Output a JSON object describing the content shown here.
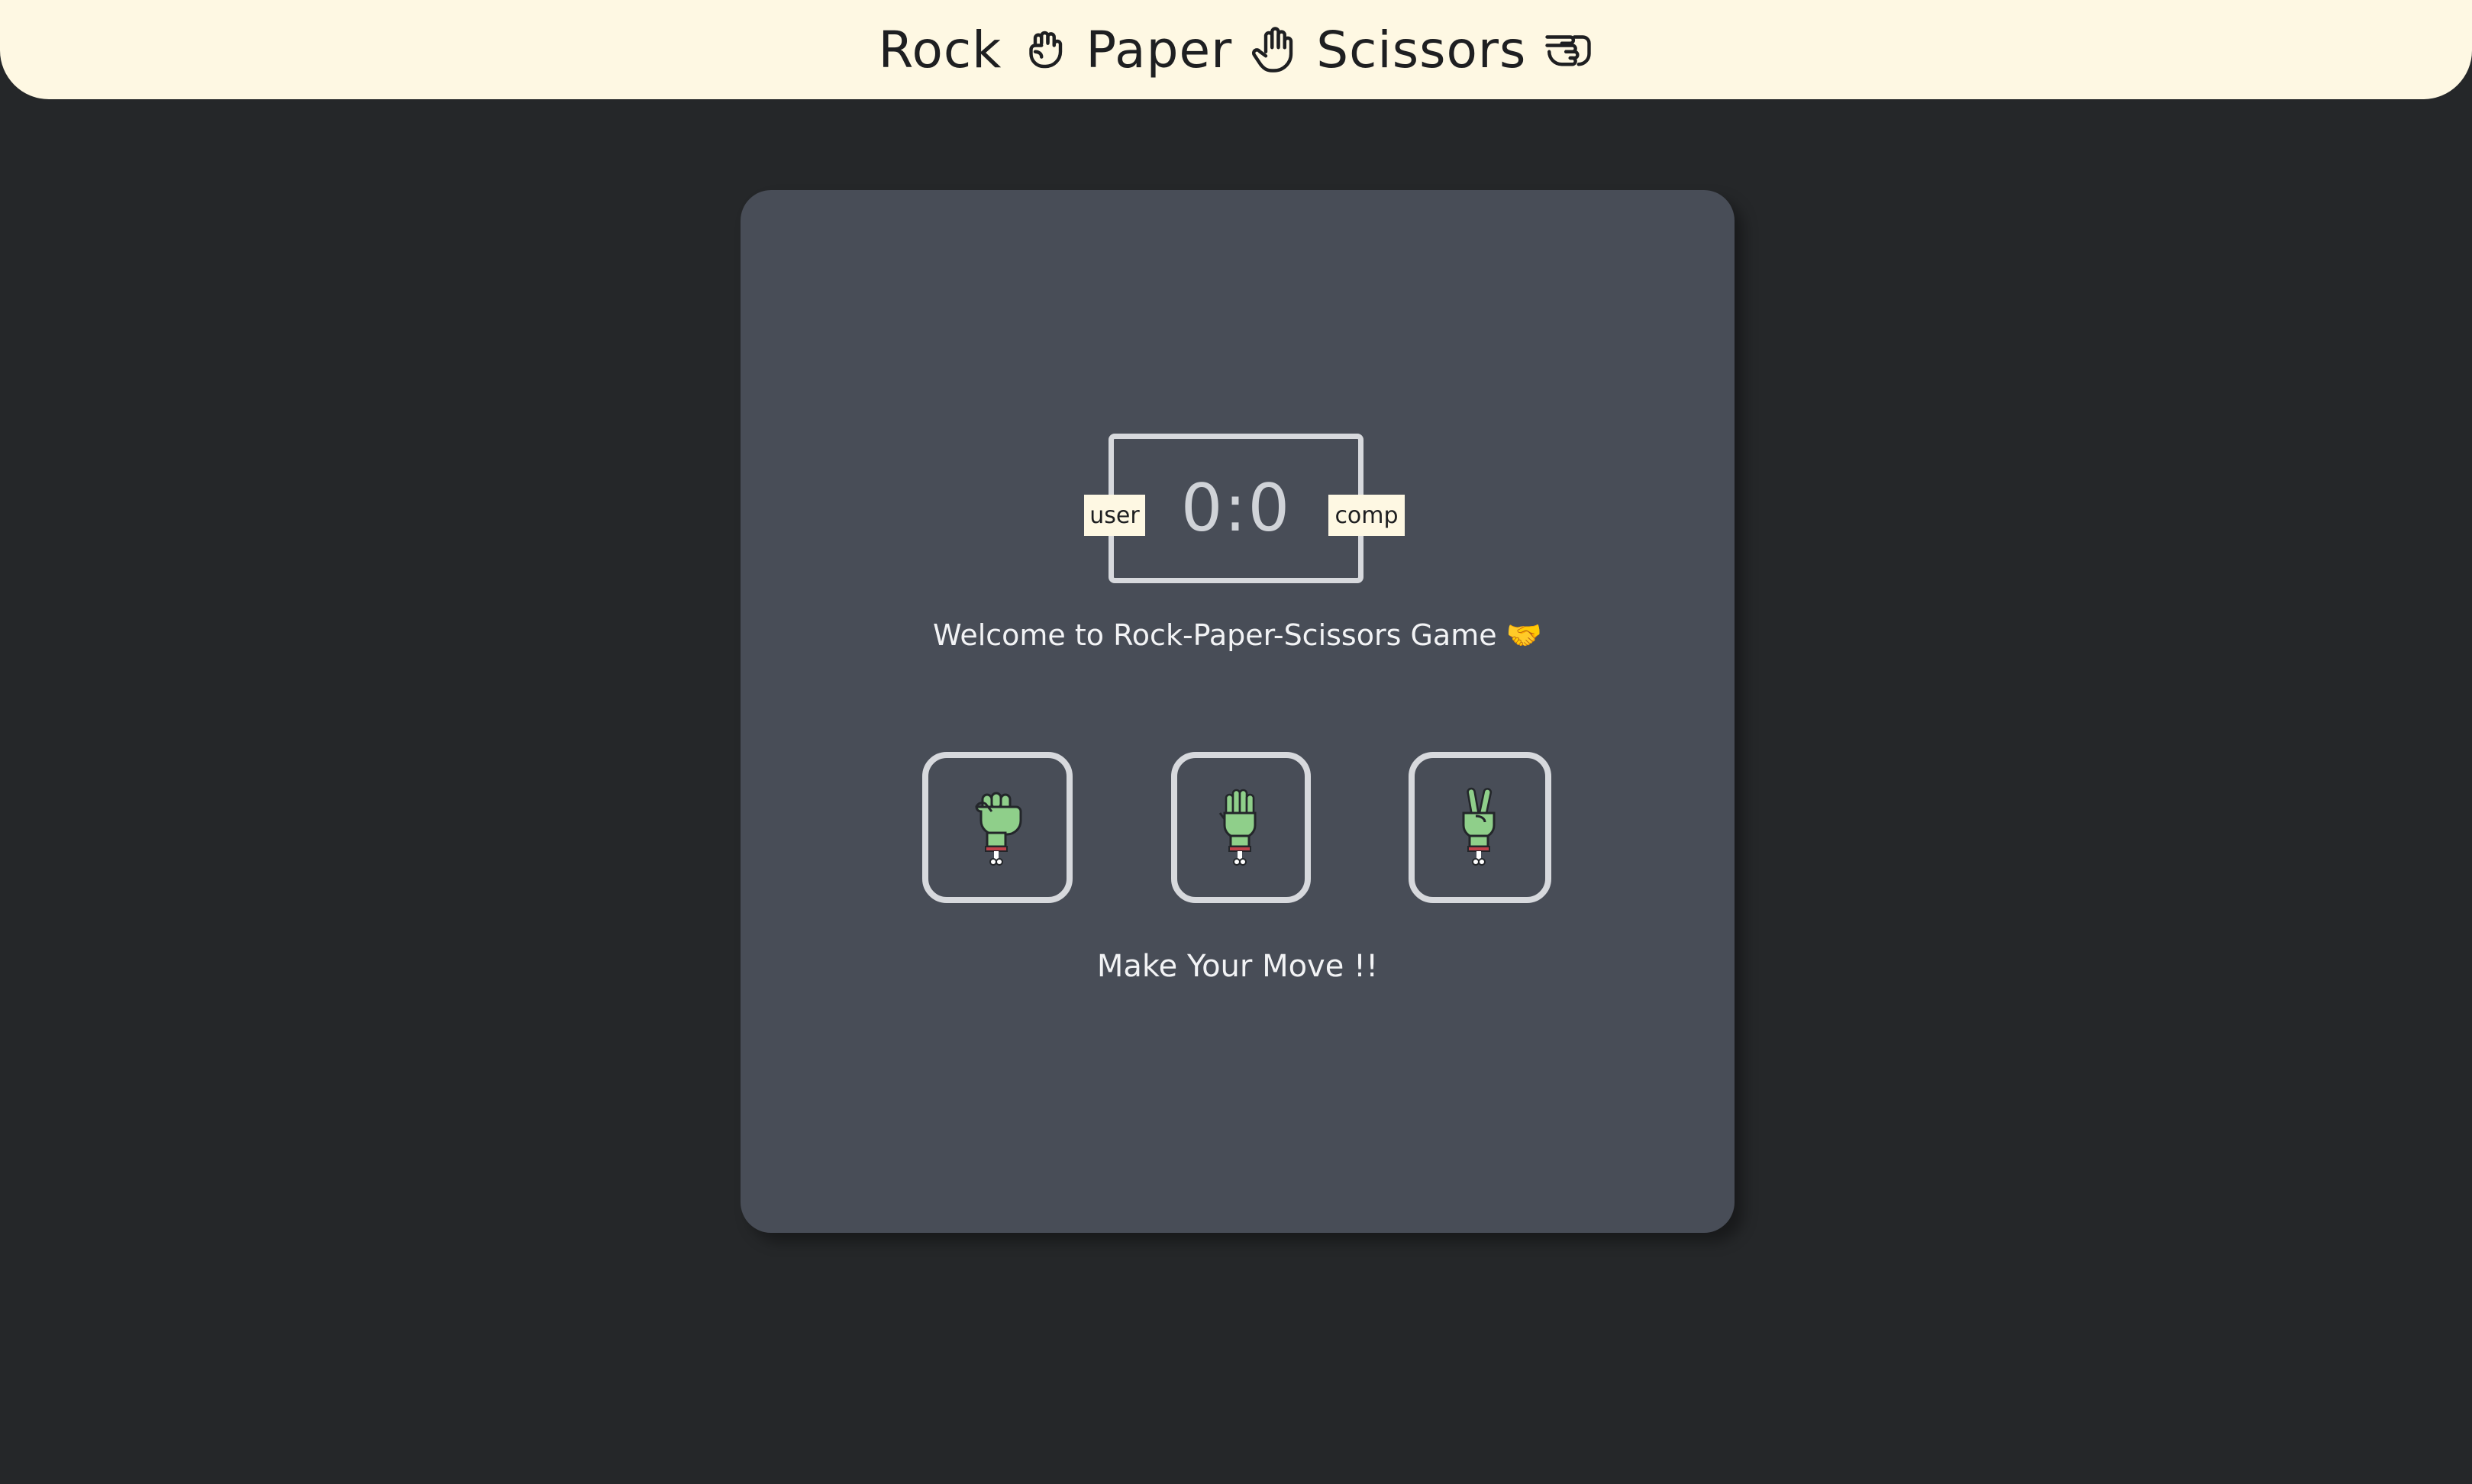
{
  "header": {
    "word1": "Rock",
    "icon1": "raised-fist-outline-icon",
    "word2": "Paper",
    "icon2": "raised-hand-outline-icon",
    "word3": "Scissors",
    "icon3": "scissors-hand-outline-icon"
  },
  "scoreboard": {
    "score": "0:0",
    "user_label": "user",
    "comp_label": "comp"
  },
  "welcome": {
    "text": "Welcome to Rock-Paper-Scissors Game 🤝"
  },
  "choices": [
    {
      "name": "rock",
      "icon": "zombie-fist-icon"
    },
    {
      "name": "paper",
      "icon": "zombie-open-hand-icon"
    },
    {
      "name": "scissors",
      "icon": "zombie-peace-hand-icon"
    }
  ],
  "message": {
    "text": "Make Your Move !!"
  },
  "colors": {
    "background": "#252729",
    "header_bg": "#fef8e3",
    "panel_bg": "#484d57",
    "border": "#d7d9dd",
    "hand_green": "#8fcf8a"
  }
}
